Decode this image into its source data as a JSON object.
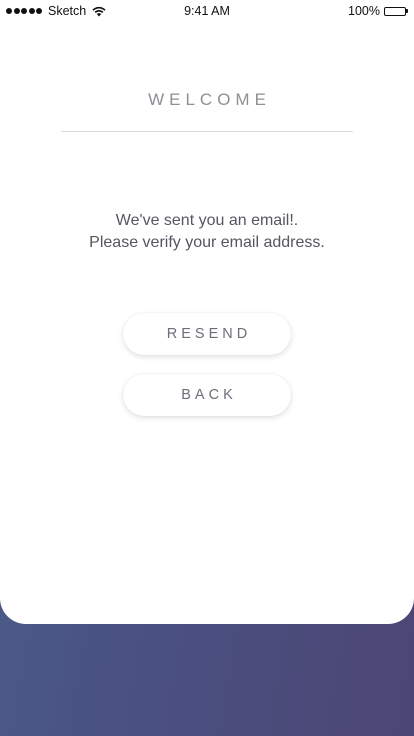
{
  "status_bar": {
    "carrier": "Sketch",
    "time": "9:41 AM",
    "battery_percent": "100%",
    "battery_level": 1.0,
    "signal_bars": 5,
    "icons": [
      "signal-dots-icon",
      "wifi-icon",
      "battery-icon"
    ]
  },
  "screen": {
    "title": "WELCOME",
    "message_line1": "We've sent you an email!.",
    "message_line2": "Please verify your email address."
  },
  "buttons": {
    "resend_label": "RESEND",
    "back_label": "BACK"
  },
  "colors": {
    "background_gradient_start": "#4a5f8c",
    "background_gradient_end": "#4c4674",
    "card": "#ffffff",
    "title_text": "#8f8f95",
    "body_text": "#55565f",
    "button_text": "#6d6e78"
  }
}
